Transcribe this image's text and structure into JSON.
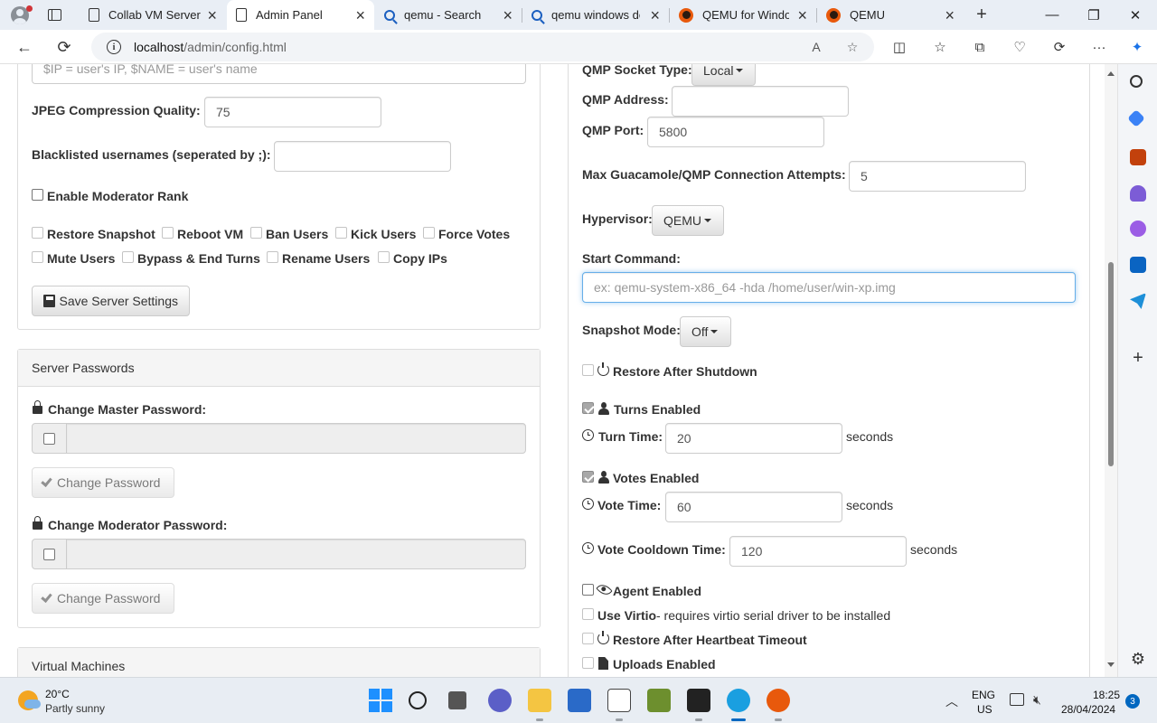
{
  "browser": {
    "tabs": [
      {
        "title": "Collab VM Server",
        "favicon": "page-icon",
        "active": false
      },
      {
        "title": "Admin Panel",
        "favicon": "page-icon",
        "active": true
      },
      {
        "title": "qemu - Search",
        "favicon": "search-icon",
        "active": false
      },
      {
        "title": "qemu windows do",
        "favicon": "search-icon",
        "active": false
      },
      {
        "title": "QEMU for Windov",
        "favicon": "qemu-icon",
        "active": false
      },
      {
        "title": "QEMU",
        "favicon": "qemu-icon",
        "active": false
      }
    ],
    "url_host": "localhost",
    "url_path": "/admin/config.html"
  },
  "server_settings": {
    "ip_name_placeholder": "$IP = user's IP, $NAME = user's name",
    "jpeg_label": "JPEG Compression Quality:",
    "jpeg_value": "75",
    "blacklist_label": "Blacklisted usernames (seperated by ;):",
    "blacklist_value": "",
    "enable_mod_rank_label": "Enable Moderator Rank",
    "enable_mod_rank_checked": false,
    "permissions": [
      {
        "label": "Restore Snapshot",
        "checked": false
      },
      {
        "label": "Reboot VM",
        "checked": false
      },
      {
        "label": "Ban Users",
        "checked": false
      },
      {
        "label": "Kick Users",
        "checked": false
      },
      {
        "label": "Force Votes",
        "checked": false
      },
      {
        "label": "Mute Users",
        "checked": false
      },
      {
        "label": "Bypass & End Turns",
        "checked": false
      },
      {
        "label": "Rename Users",
        "checked": false
      },
      {
        "label": "Copy IPs",
        "checked": false
      }
    ],
    "save_button": "Save Server Settings"
  },
  "passwords": {
    "heading": "Server Passwords",
    "master_label": "Change Master Password:",
    "moderator_label": "Change Moderator Password:",
    "change_button": "Change Password"
  },
  "vms": {
    "heading": "Virtual Machines"
  },
  "vm_config": {
    "qmp_socket_type_label": "QMP Socket Type:",
    "qmp_socket_type_value": "Local",
    "qmp_address_label": "QMP Address:",
    "qmp_address_value": "",
    "qmp_port_label": "QMP Port:",
    "qmp_port_value": "5800",
    "max_attempts_label": "Max Guacamole/QMP Connection Attempts:",
    "max_attempts_value": "5",
    "hypervisor_label": "Hypervisor:",
    "hypervisor_value": "QEMU",
    "start_command_label": "Start Command:",
    "start_command_placeholder": "ex: qemu-system-x86_64 -hda /home/user/win-xp.img",
    "snapshot_mode_label": "Snapshot Mode:",
    "snapshot_mode_value": "Off",
    "restore_after_shutdown_label": "Restore After Shutdown",
    "turns_enabled_label": "Turns Enabled",
    "turns_enabled_checked": true,
    "turn_time_label": "Turn Time:",
    "turn_time_value": "20",
    "votes_enabled_label": "Votes Enabled",
    "votes_enabled_checked": true,
    "vote_time_label": "Vote Time:",
    "vote_time_value": "60",
    "vote_cooldown_label": "Vote Cooldown Time:",
    "vote_cooldown_value": "120",
    "seconds_unit": "seconds",
    "agent_enabled_label": "Agent Enabled",
    "use_virtio_label": "Use Virtio",
    "use_virtio_note": " - requires virtio serial driver to be installed",
    "restore_heartbeat_label": "Restore After Heartbeat Timeout",
    "uploads_enabled_label": "Uploads Enabled"
  },
  "taskbar": {
    "temperature": "20°C",
    "weather": "Partly sunny",
    "language_line1": "ENG",
    "language_line2": "US",
    "time": "18:25",
    "date": "28/04/2024",
    "notification_count": "3"
  }
}
